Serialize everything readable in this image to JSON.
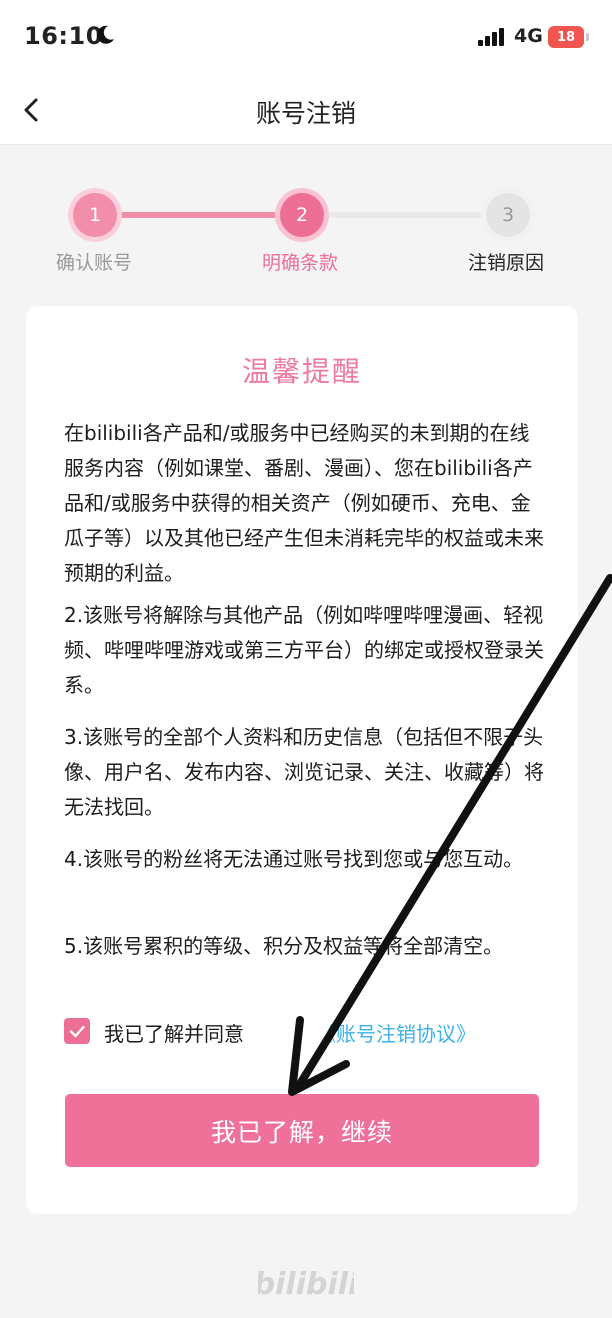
{
  "status_bar": {
    "time": "16:10",
    "network": "4G",
    "battery": "18"
  },
  "nav": {
    "title": "账号注销"
  },
  "steps": [
    {
      "number": "1",
      "label": "确认账号"
    },
    {
      "number": "2",
      "label": "明确条款"
    },
    {
      "number": "3",
      "label": "注销原因"
    }
  ],
  "card": {
    "title": "温馨提醒",
    "paragraphs": [
      "在bilibili各产品和/或服务中已经购买的未到期的在线服务内容（例如课堂、番剧、漫画）、您在bilibili各产品和/或服务中获得的相关资产（例如硬币、充电、金瓜子等）以及其他已经产生但未消耗完毕的权益或未来预期的利益。",
      "2.该账号将解除与其他产品（例如哔哩哔哩漫画、轻视频、哔哩哔哩游戏或第三方平台）的绑定或授权登录关系。",
      "3.该账号的全部个人资料和历史信息（包括但不限于头像、用户名、发布内容、浏览记录、关注、收藏等）将无法找回。",
      "4.该账号的粉丝将无法通过账号找到您或与您互动。",
      "5.该账号累积的等级、积分及权益等将全部清空。"
    ],
    "agree_text": "我已了解并同意",
    "agree_link": "《账号注销协议》",
    "agree_checked": true,
    "continue_label": "我已了解，继续"
  },
  "colors": {
    "accent": "#ee6f96",
    "link": "#3bb2e8"
  }
}
